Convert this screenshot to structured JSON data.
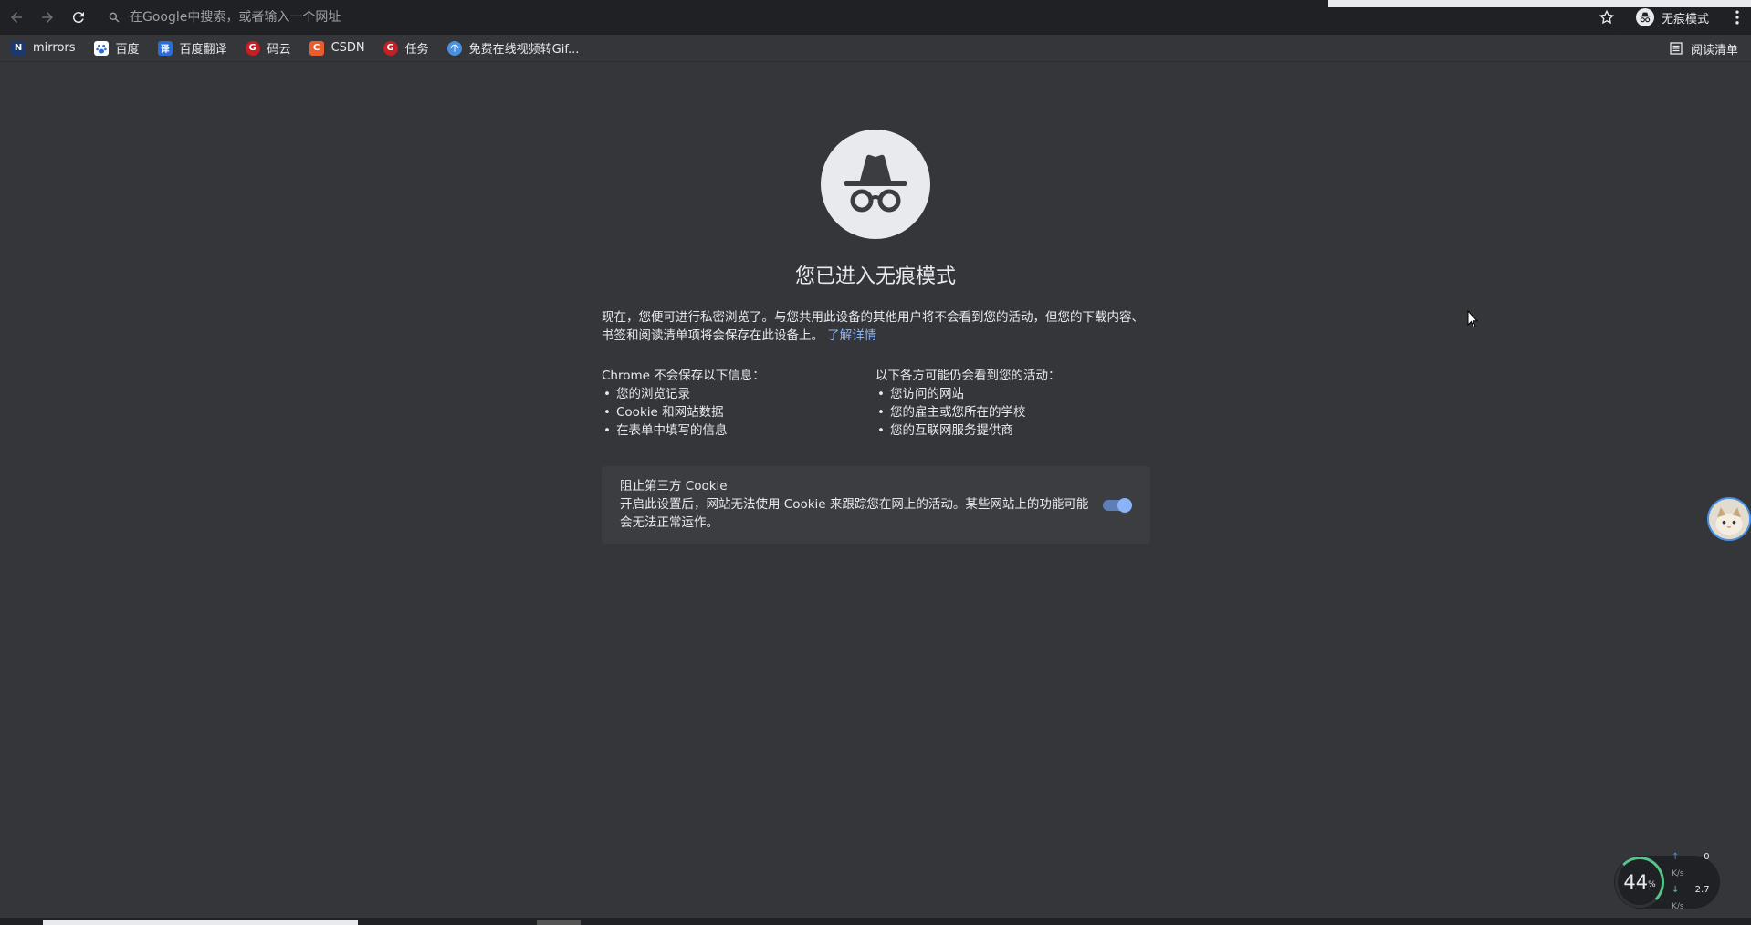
{
  "omnibox": {
    "placeholder": "在Google中搜索，或者输入一个网址"
  },
  "profile": {
    "label": "无痕模式"
  },
  "bookmarks": [
    {
      "label": "mirrors",
      "fav_text": "N",
      "fav_color": "#1a3a6e"
    },
    {
      "label": "百度",
      "fav_text": "",
      "fav_color": "#2b6cd6"
    },
    {
      "label": "百度翻译",
      "fav_text": "译",
      "fav_color": "#2b6cd6"
    },
    {
      "label": "码云",
      "fav_text": "G",
      "fav_color": "#c71d23"
    },
    {
      "label": "CSDN",
      "fav_text": "C",
      "fav_color": "#e85d2f"
    },
    {
      "label": "任务",
      "fav_text": "G",
      "fav_color": "#c71d23"
    },
    {
      "label": "免费在线视频转Gif...",
      "fav_text": "",
      "fav_color": "#4a90e2"
    }
  ],
  "reading_list": {
    "label": "阅读清单"
  },
  "main": {
    "title": "您已进入无痕模式",
    "intro": "现在，您便可进行私密浏览了。与您共用此设备的其他用户将不会看到您的活动，但您的下载内容、书签和阅读清单项将会保存在此设备上。",
    "learn_more": "了解详情",
    "left_heading": "Chrome 不会保存以下信息：",
    "left_items": [
      "您的浏览记录",
      "Cookie 和网站数据",
      "在表单中填写的信息"
    ],
    "right_heading": "以下各方可能仍会看到您的活动：",
    "right_items": [
      "您访问的网站",
      "您的雇主或您所在的学校",
      "您的互联网服务提供商"
    ]
  },
  "cookie_card": {
    "title": "阻止第三方 Cookie",
    "description": "开启此设置后，网站无法使用 Cookie 来跟踪您在网上的活动。某些网站上的功能可能会无法正常运作。",
    "enabled": true
  },
  "net_widget": {
    "cpu_percent": "44",
    "cpu_unit": "%",
    "up_value": "0",
    "up_unit": "K/s",
    "down_value": "2.7",
    "down_unit": "K/s"
  },
  "colors": {
    "page_bg": "#35363a",
    "toolbar_bg": "#202124",
    "link": "#8ab4f8",
    "toggle_on": "#8ab4f8"
  }
}
